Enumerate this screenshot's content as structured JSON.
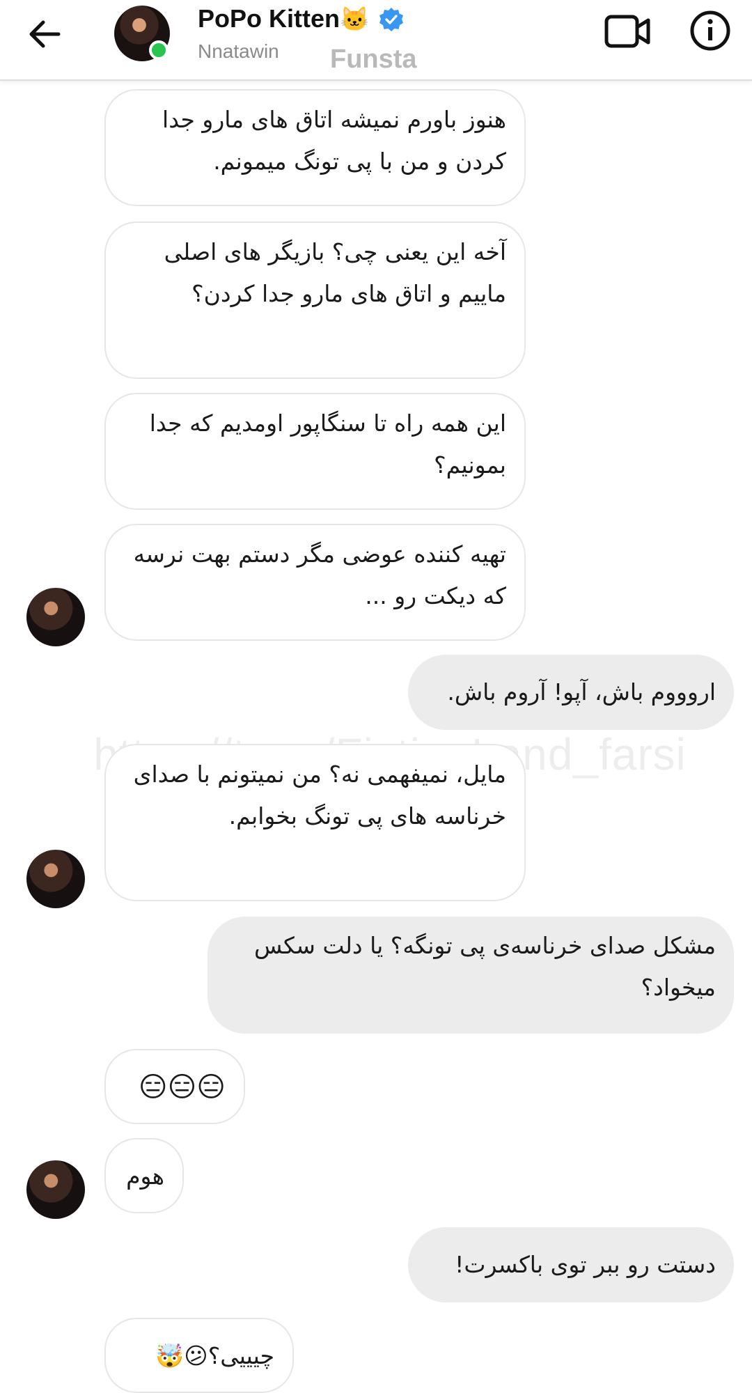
{
  "header": {
    "contact_name": "PoPo Kitten",
    "contact_emoji": "🐱",
    "verified_icon": "verified-badge-icon",
    "handle": "Nnatawin",
    "app_watermark": "Funsta",
    "accent_color": "#3897f0",
    "online_color": "#2bc44e"
  },
  "watermark": {
    "url": "https://t.me/FictionLand_farsi"
  },
  "messages": [
    {
      "sender": "contact",
      "text": "هنوز باورم نمیشه اتاق های مارو جدا کردن و من با پی تونگ میمونم."
    },
    {
      "sender": "contact",
      "text": "آخه این یعنی چی؟ بازیگر های اصلی ماییم و اتاق های مارو جدا کردن؟"
    },
    {
      "sender": "contact",
      "text": "این همه راه تا سنگاپور اومدیم که جدا بمونیم؟"
    },
    {
      "sender": "contact",
      "text": "تهیه کننده عوضی مگر دستم بهت نرسه که دیکت رو ..."
    },
    {
      "sender": "me",
      "text": "اروووم باش، آپو! آروم باش."
    },
    {
      "sender": "contact",
      "text": "مایل، نمیفهمی نه؟ من نمیتونم با صدای خرناسه های پی تونگ بخوابم."
    },
    {
      "sender": "me",
      "text": "مشکل صدای خرناسه‌ی پی تونگه؟ یا دلت سکس میخواد؟"
    },
    {
      "sender": "contact",
      "text": "😑😑😑"
    },
    {
      "sender": "contact",
      "text": "هوم"
    },
    {
      "sender": "me",
      "text": "دستت رو ببر توی باکسرت!"
    },
    {
      "sender": "contact",
      "text": "چیییی؟😕🤯"
    }
  ]
}
